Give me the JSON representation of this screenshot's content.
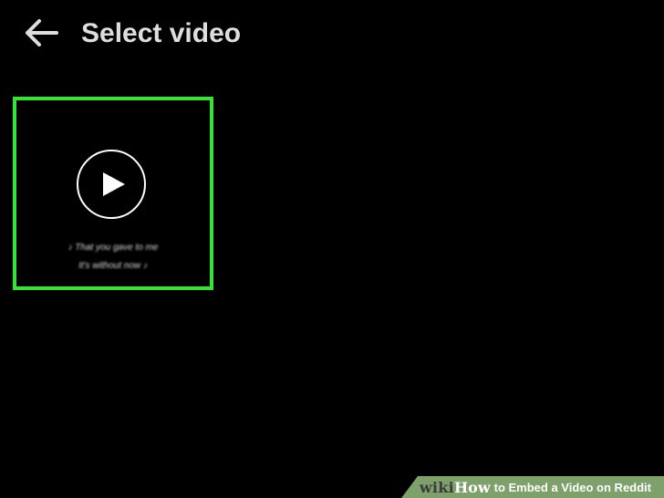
{
  "header": {
    "back_icon": "arrow-left-icon",
    "title": "Select video"
  },
  "videos": [
    {
      "selected": true,
      "play_icon": "play-icon",
      "caption_lines": [
        "♪ That you gave to me",
        "It's without now ♪"
      ]
    }
  ],
  "watermark": {
    "wiki": "wiki",
    "how": "How",
    "title": "to Embed a Video on Reddit"
  },
  "colors": {
    "background": "#000000",
    "selection_border": "#35e335",
    "title_text": "#dedede",
    "watermark_bg": "#7ea06a"
  }
}
